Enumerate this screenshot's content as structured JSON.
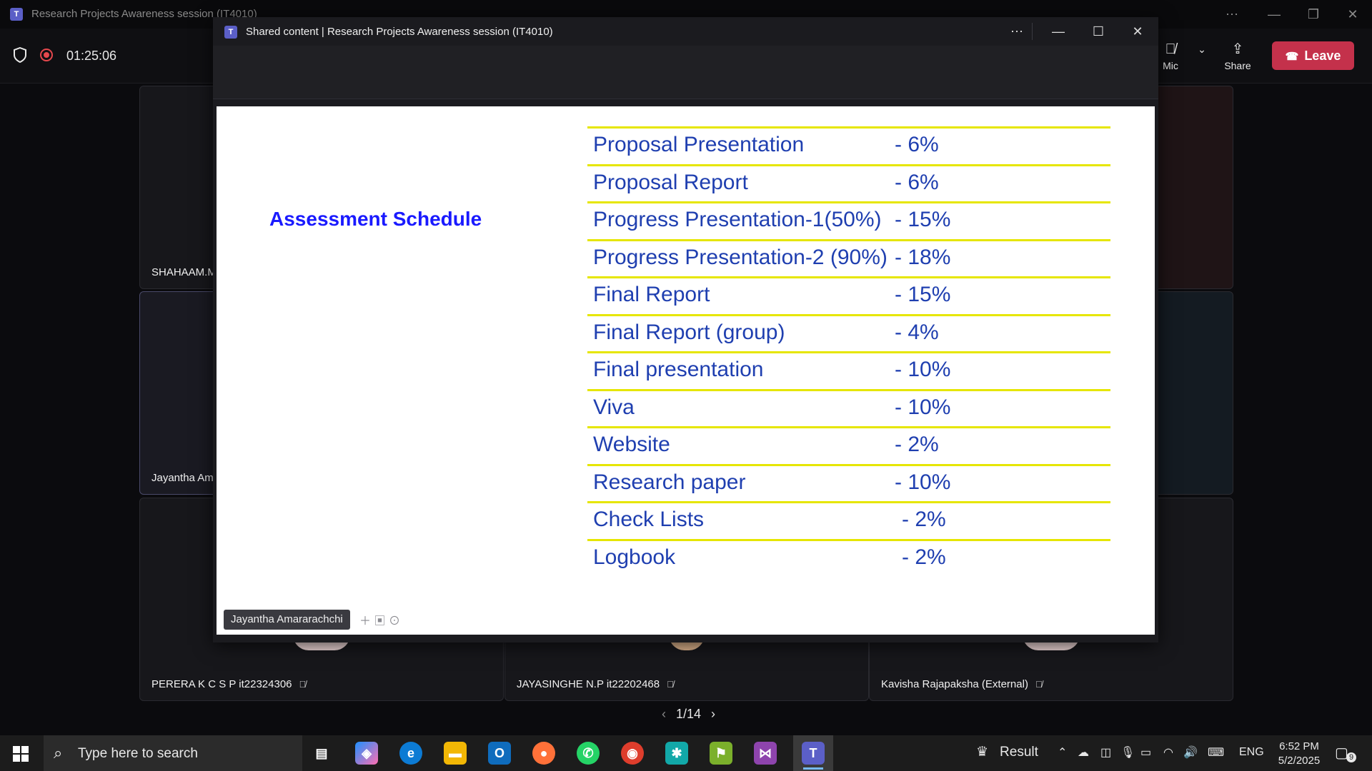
{
  "window": {
    "title": "Research Projects Awareness session (IT4010)",
    "icon": "teams-icon"
  },
  "meeting": {
    "timer": "01:25:06",
    "mic_label": "Mic",
    "share_label": "Share",
    "leave_label": "Leave"
  },
  "tiles": [
    {
      "name": "SHAHAAM.M"
    },
    {
      "name": "Jayantha Ama"
    },
    {
      "name": "PERERA K C S P it22324306"
    },
    {
      "name": "JAYASINGHE N.P it22202468"
    },
    {
      "name": "Kavisha Rajapaksha (External)"
    }
  ],
  "shared": {
    "title": "Shared content | Research Projects Awareness session (IT4010)",
    "slide_heading": "Assessment Schedule",
    "rows": [
      {
        "item": "Proposal Presentation",
        "percent": "- 6%"
      },
      {
        "item": "Proposal Report",
        "percent": "- 6%"
      },
      {
        "item": "Progress Presentation-1(50%)",
        "percent": "- 15%"
      },
      {
        "item": "Progress Presentation-2 (90%)",
        "percent": "- 18%"
      },
      {
        "item": "Final Report",
        "percent": "- 15%"
      },
      {
        "item": "Final Report (group)",
        "percent": "- 4%"
      },
      {
        "item": "Final presentation",
        "percent": "- 10%"
      },
      {
        "item": "Viva",
        "percent": "- 10%"
      },
      {
        "item": "Website",
        "percent": "- 2%"
      },
      {
        "item": "Research paper",
        "percent": "- 10%"
      },
      {
        "item": "Check Lists",
        "percent": "- 2%"
      },
      {
        "item": "Logbook",
        "percent": "- 2%"
      }
    ],
    "presenter": "Jayantha Amararachchi"
  },
  "pager": {
    "text": "1/14"
  },
  "taskbar": {
    "search_placeholder": "Type here to search",
    "tray_app": "Result",
    "language": "ENG",
    "time": "6:52 PM",
    "date": "5/2/2025",
    "notification_count": "9"
  },
  "colors": {
    "slide_heading": "#1a1aff",
    "slide_text": "#1f3fb0",
    "row_line": "#e6e600",
    "leave": "#c4314b"
  }
}
